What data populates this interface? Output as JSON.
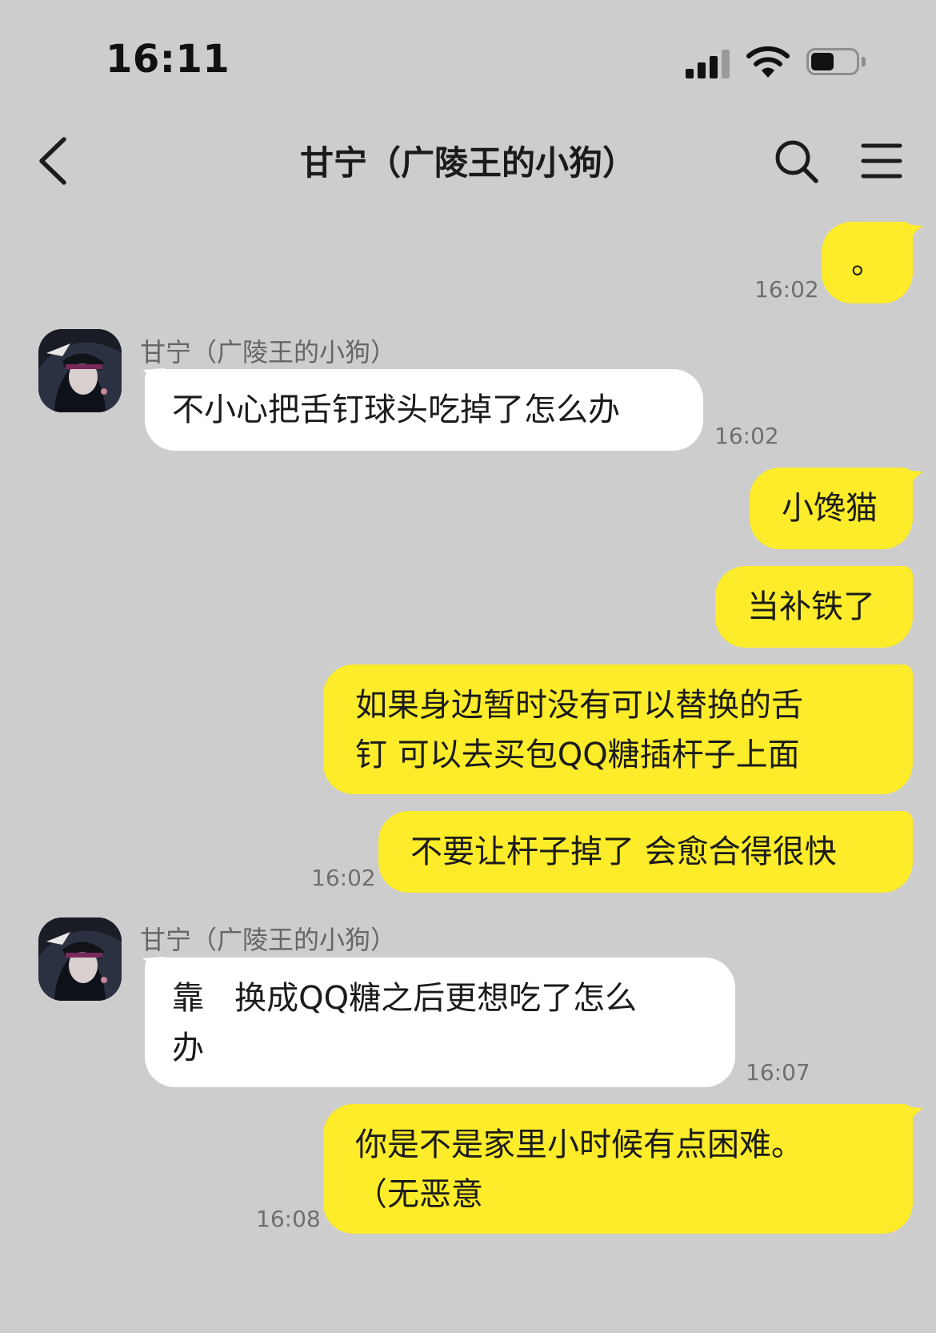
{
  "status_bar": {
    "time": "16:11"
  },
  "nav": {
    "title": "甘宁（广陵王的小狗）"
  },
  "colors": {
    "background": "#cdcdcd",
    "my_bubble": "#fcec29",
    "their_bubble": "#ffffff",
    "time_text": "#6f6f6f"
  },
  "icons": {
    "back": "chevron-left-icon",
    "search": "search-icon",
    "menu": "menu-icon",
    "signal": "signal-icon",
    "wifi": "wifi-icon",
    "battery": "battery-icon"
  },
  "messages": [
    {
      "from": "me",
      "text": "。",
      "time": "16:02"
    },
    {
      "from": "them",
      "sender": "甘宁（广陵王的小狗）",
      "text": "不小心把舌钉球头吃掉了怎么办",
      "time": "16:02"
    },
    {
      "from": "me",
      "text": "小馋猫"
    },
    {
      "from": "me",
      "text": "当补铁了"
    },
    {
      "from": "me",
      "text": "如果身边暂时没有可以替换的舌\n钉 可以去买包QQ糖插杆子上面"
    },
    {
      "from": "me",
      "text": "不要让杆子掉了 会愈合得很快",
      "time": "16:02"
    },
    {
      "from": "them",
      "sender": "甘宁（广陵王的小狗）",
      "text": "靠   换成QQ糖之后更想吃了怎么\n办",
      "time": "16:07"
    },
    {
      "from": "me",
      "text": "你是不是家里小时候有点困难。\n（无恶意",
      "time": "16:08"
    }
  ]
}
